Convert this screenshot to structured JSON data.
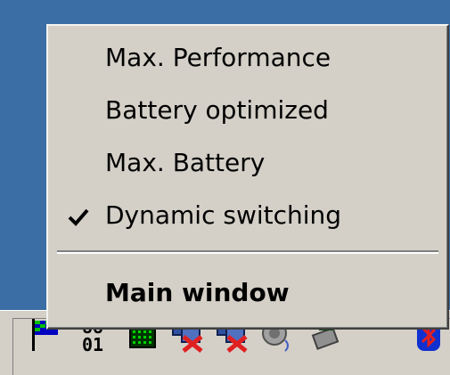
{
  "colors": {
    "desktop": "#3a6ea5",
    "menu_bg": "#d4d0c8",
    "text": "#000000",
    "error_x": "#e02020"
  },
  "menu": {
    "items": [
      {
        "label": "Max. Performance",
        "checked": false,
        "bold": false
      },
      {
        "label": "Battery optimized",
        "checked": false,
        "bold": false
      },
      {
        "label": "Max. Battery",
        "checked": false,
        "bold": false
      },
      {
        "label": "Dynamic switching",
        "checked": true,
        "bold": false
      }
    ],
    "main_window_label": "Main window"
  },
  "tray": {
    "icons": [
      "flag-icon",
      "digital-clock-icon",
      "cpu-chip-icon",
      "network-disconnected-icon",
      "network-disconnected-icon",
      "speaker-icon",
      "wireless-device-icon",
      "bluetooth-icon"
    ],
    "clock_text": "01"
  }
}
